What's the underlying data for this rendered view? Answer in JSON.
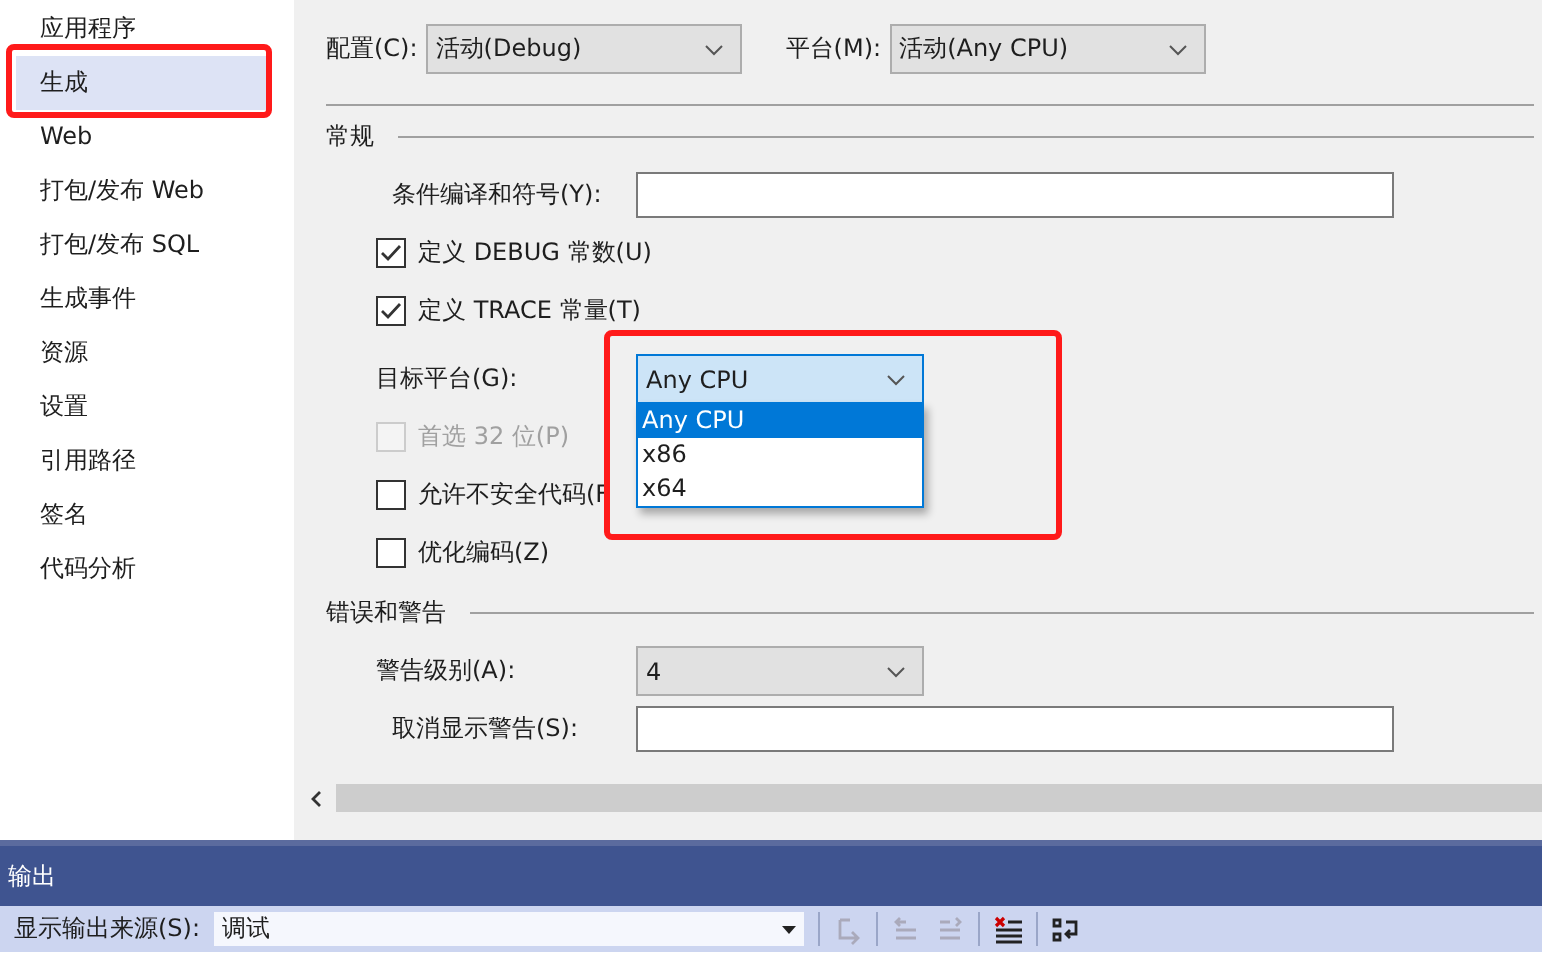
{
  "sidebar": {
    "items": [
      {
        "label": "应用程序",
        "selected": false,
        "highlighted": false
      },
      {
        "label": "生成",
        "selected": true,
        "highlighted": true
      },
      {
        "label": "Web",
        "selected": false,
        "highlighted": false
      },
      {
        "label": "打包/发布 Web",
        "selected": false,
        "highlighted": false
      },
      {
        "label": "打包/发布 SQL",
        "selected": false,
        "highlighted": false
      },
      {
        "label": "生成事件",
        "selected": false,
        "highlighted": false
      },
      {
        "label": "资源",
        "selected": false,
        "highlighted": false
      },
      {
        "label": "设置",
        "selected": false,
        "highlighted": false
      },
      {
        "label": "引用路径",
        "selected": false,
        "highlighted": false
      },
      {
        "label": "签名",
        "selected": false,
        "highlighted": false
      },
      {
        "label": "代码分析",
        "selected": false,
        "highlighted": false
      }
    ]
  },
  "toolbar": {
    "configuration_label": "配置(C):",
    "configuration_value": "活动(Debug)",
    "platform_label": "平台(M):",
    "platform_value": "活动(Any CPU)"
  },
  "sections": [
    {
      "title": "常规",
      "rows": [
        {
          "kind": "text",
          "label": "条件编译和符号(Y):"
        },
        {
          "kind": "checkbox",
          "label": "定义 DEBUG 常数(U)",
          "checked": true,
          "disabled": false
        },
        {
          "kind": "checkbox",
          "label": "定义 TRACE 常量(T)",
          "checked": true,
          "disabled": false
        },
        {
          "kind": "combo",
          "label": "目标平台(G):",
          "value": "Any CPU",
          "focused": true,
          "highlighted": true,
          "options": [
            {
              "label": "Any CPU",
              "selected": true
            },
            {
              "label": "x86",
              "selected": false
            },
            {
              "label": "x64",
              "selected": false
            }
          ]
        },
        {
          "kind": "checkbox",
          "label": "首选 32 位(P)",
          "checked": false,
          "disabled": true
        },
        {
          "kind": "checkbox",
          "label": "允许不安全代码(F",
          "checked": false,
          "disabled": false
        },
        {
          "kind": "checkbox",
          "label": "优化编码(Z)",
          "checked": false,
          "disabled": false
        }
      ]
    },
    {
      "title": "错误和警告",
      "rows": [
        {
          "kind": "combo",
          "label": "警告级别(A):",
          "value": "4",
          "focused": false,
          "highlighted": false
        },
        {
          "kind": "text",
          "label": "取消显示警告(S):"
        }
      ]
    }
  ],
  "output": {
    "title": "输出",
    "source_label": "显示输出来源(S):",
    "source_value": "调试"
  }
}
